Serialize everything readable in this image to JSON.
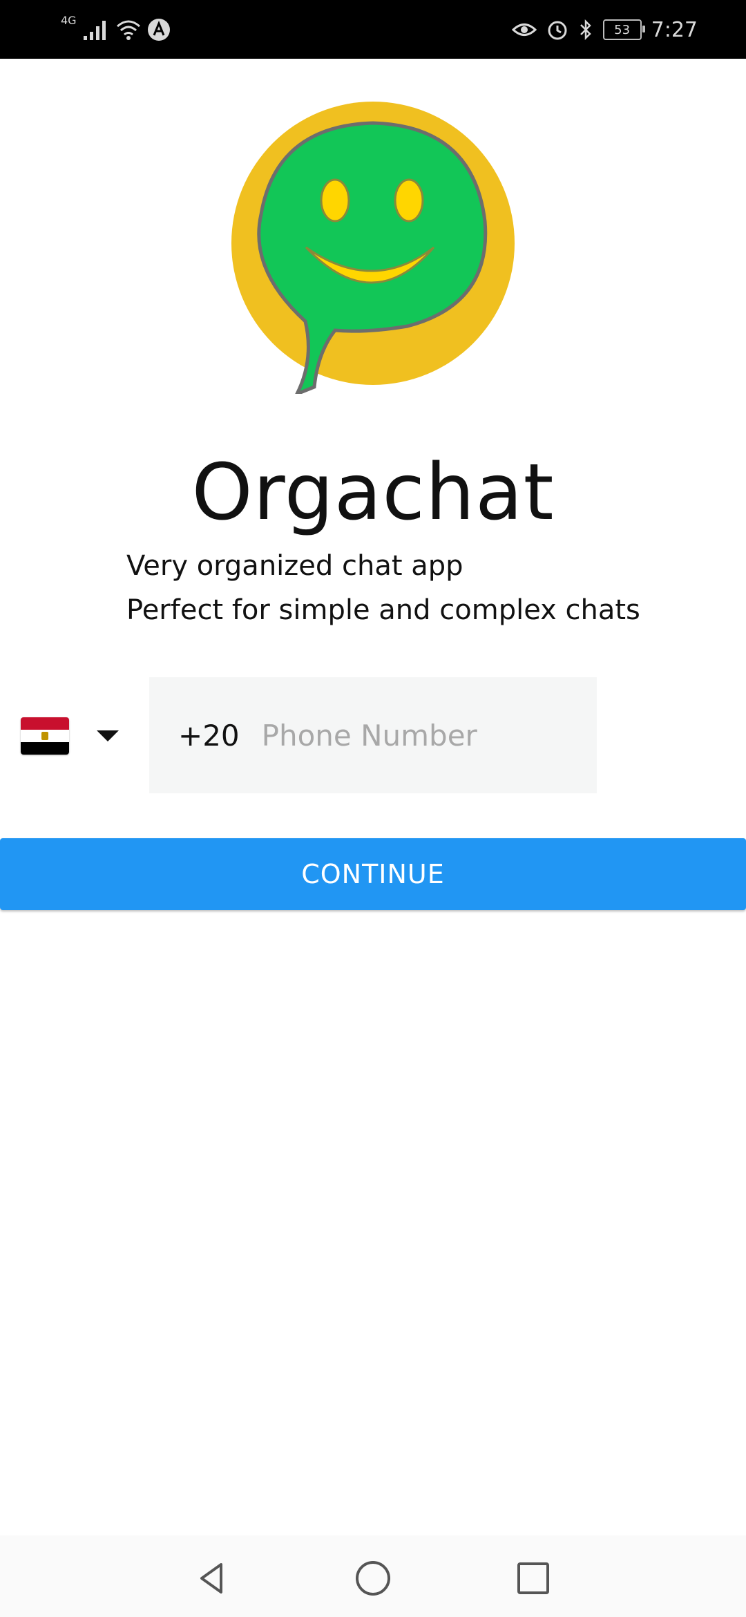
{
  "status_bar": {
    "network_type": "4G",
    "time": "7:27",
    "battery_level": "53"
  },
  "app": {
    "name": "Orgachat",
    "tagline_line1": "Very organized chat app",
    "tagline_line2": "Perfect for simple and complex chats"
  },
  "phone_form": {
    "country_flag": "egypt-flag-icon",
    "dial_code": "+20",
    "phone_placeholder": "Phone Number",
    "phone_value": "",
    "continue_label": "CONTINUE"
  },
  "colors": {
    "primary_button": "#2196f3",
    "logo_outer": "#f0c020",
    "logo_bubble": "#12c657",
    "logo_face": "#ffd600"
  }
}
